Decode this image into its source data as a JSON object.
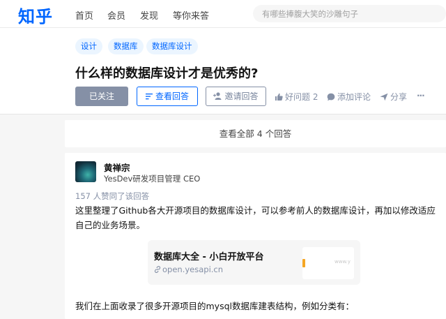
{
  "topbar": {
    "logo": "知乎",
    "nav": [
      "首页",
      "会员",
      "发现",
      "等你来答"
    ],
    "search_placeholder": "有哪些捧腹大笑的沙雕句子"
  },
  "question": {
    "tags": [
      "设计",
      "数据库",
      "数据库设计"
    ],
    "title": "什么样的数据库设计才是优秀的?",
    "followed_label": "已关注",
    "view_answers_label": "查看回答",
    "invite_label": "邀请回答",
    "good_question_label": "好问题 2",
    "comment_label": "添加评论",
    "share_label": "分享",
    "more_label": "···"
  },
  "view_all_label": "查看全部 4 个回答",
  "answer": {
    "author_name": "黄禅宗",
    "author_bio": "YesDev研发项目管理 CEO",
    "votes_text": "157 人赞同了该回答",
    "paragraph1": "这里整理了Github各大开源项目的数据库设计，可以参考前人的数据库设计，再加以修改适应自己的业务场景。",
    "link_card": {
      "title": "数据库大全 - 小白开放平台",
      "url": "open.yesapi.cn",
      "thumb_text": "www.y"
    },
    "paragraph2": "我们在上面收录了很多开源项目的mysql数据库建表结构，例如分类有："
  },
  "colors": {
    "brand": "#0066ff",
    "muted": "#8590a6",
    "tag_bg": "#ebf5ff"
  }
}
